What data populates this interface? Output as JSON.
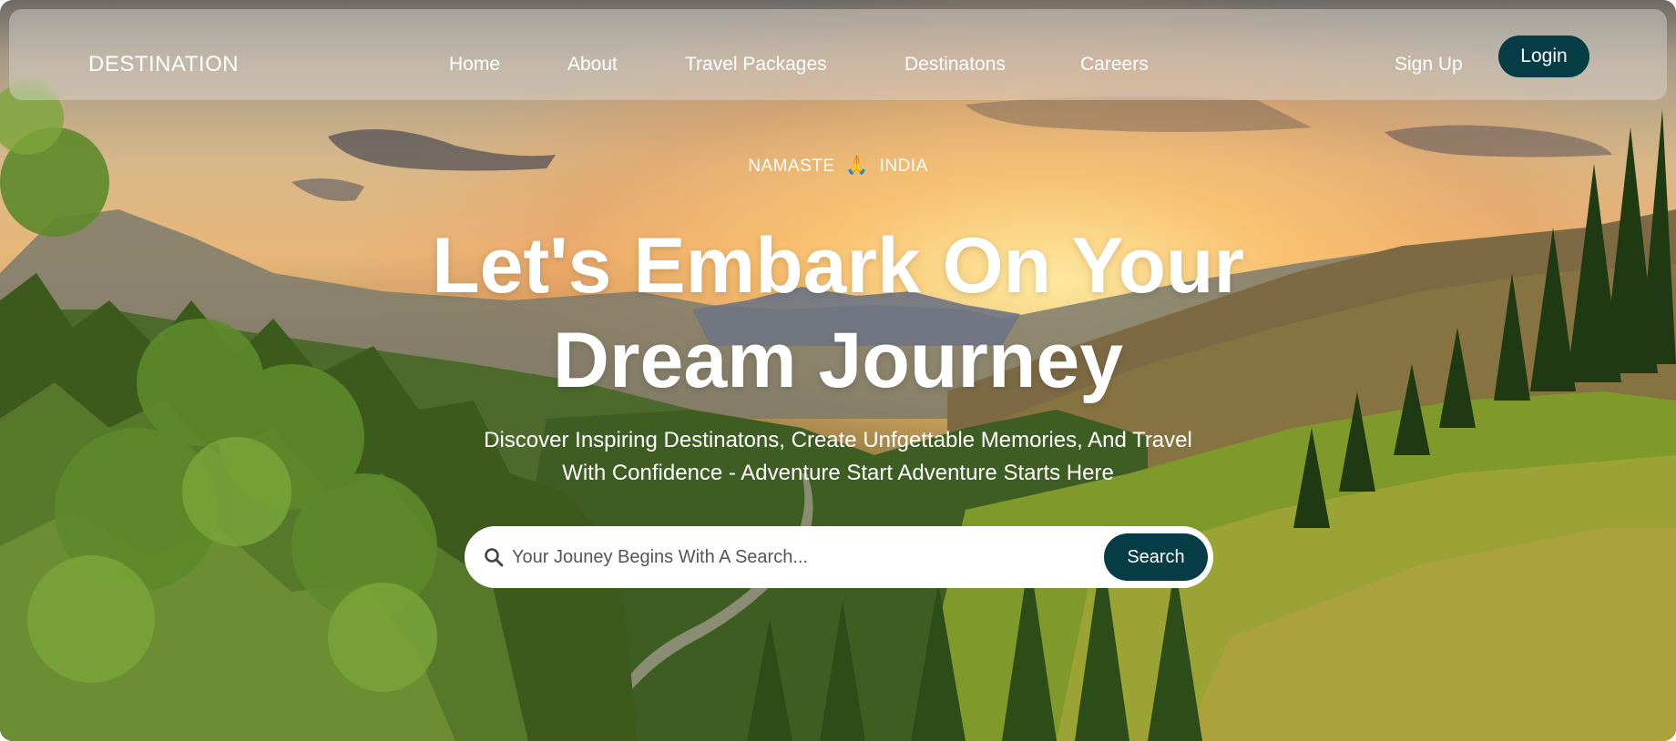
{
  "nav": {
    "brand": "DESTINATION",
    "links": [
      "Home",
      "About",
      "Travel Packages",
      "Destinatons",
      "Careers"
    ],
    "signup_label": "Sign Up",
    "login_label": "Login"
  },
  "hero": {
    "greeting_left": "NAMASTE",
    "greeting_emoji": "🙏",
    "greeting_right": "INDIA",
    "headline_line1": "Let's Embark On Your",
    "headline_line2": "Dream Journey",
    "subtitle_line1": "Discover Inspiring Destinatons, Create Unfgettable Memories, And Travel",
    "subtitle_line2": "With Confidence - Adventure Start Adventure Starts Here"
  },
  "search": {
    "placeholder": "Your Jouney Begins With A Search...",
    "value": "",
    "button_label": "Search"
  },
  "colors": {
    "accent": "#063c45",
    "text": "#ffffff"
  }
}
